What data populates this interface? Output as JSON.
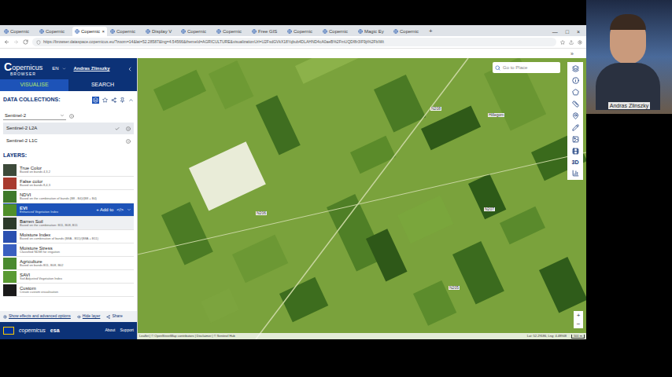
{
  "browser": {
    "tabs": [
      {
        "label": "Copernic",
        "selected": false
      },
      {
        "label": "Copernic",
        "selected": false
      },
      {
        "label": "Copernic",
        "selected": true
      },
      {
        "label": "Copernic",
        "selected": false
      },
      {
        "label": "Display V",
        "selected": false
      },
      {
        "label": "Copernic",
        "selected": false
      },
      {
        "label": "Copernic",
        "selected": false
      },
      {
        "label": "Free GIS",
        "selected": false
      },
      {
        "label": "Copernic",
        "selected": false
      },
      {
        "label": "Copernic",
        "selected": false
      },
      {
        "label": "Magic Ey",
        "selected": false
      },
      {
        "label": "Copernic",
        "selected": false
      }
    ],
    "tab_close": "×",
    "new_tab": "+",
    "window_controls": [
      "—",
      "□",
      "×"
    ],
    "url": "https://browser.dataspace.copernicus.eu/?zoom=14&lat=52.28587&lng=4.54566&themeId=AGRICULTURE&visualizationUrl=U2FsdGVkX18Yqbub4DLAHND4cA0aeB%2FmUQDf8r3IF9jt%2FbIWt",
    "overflow": "»"
  },
  "app": {
    "logo": {
      "name": "opernicus",
      "sub": "BROWSER",
      "initial": "C"
    },
    "language": "EN",
    "user": "Andras Zlinszky",
    "tabs": [
      {
        "label": "VISUALISE",
        "selected": true
      },
      {
        "label": "SEARCH",
        "selected": false
      }
    ],
    "data_collections": {
      "label": "DATA COLLECTIONS:",
      "dropdown": "Sentinel-2",
      "items": [
        {
          "label": "Sentinel-2 L2A",
          "selected": true
        },
        {
          "label": "Sentinel-2 L1C",
          "selected": false
        }
      ]
    },
    "layers": {
      "label": "LAYERS:",
      "items": [
        {
          "title": "True Color",
          "description": "Based on bands 4,3,2",
          "selected": false,
          "hovered": false,
          "color": "#3d4a3a"
        },
        {
          "title": "False color",
          "description": "Based on bands 8,4,3",
          "selected": false,
          "hovered": false,
          "color": "#a83a2e"
        },
        {
          "title": "NDVI",
          "description": "Based on the combination of bands (B8 - B4)/(B8 + B4)",
          "selected": false,
          "hovered": false,
          "color": "#3f7a2a"
        },
        {
          "title": "EVI",
          "description": "Enhanced Vegetation Index",
          "selected": true,
          "hovered": false,
          "color": "#4f8f2a"
        },
        {
          "title": "Barren Soil",
          "description": "Based on the combination: B11, B08, B11",
          "selected": false,
          "hovered": true,
          "color": "#2c3a2a"
        },
        {
          "title": "Moisture Index",
          "description": "Based on combination of bands (B8A - B11)/(B8A + B11)",
          "selected": false,
          "hovered": false,
          "color": "#2a4fb0"
        },
        {
          "title": "Moisture Stress",
          "description": "Classified NDMI for irrigation",
          "selected": false,
          "hovered": false,
          "color": "#3a5fc0"
        },
        {
          "title": "Agriculture",
          "description": "Based on bands B11, B08, B02",
          "selected": false,
          "hovered": false,
          "color": "#4a8a30"
        },
        {
          "title": "SAVI",
          "description": "Soil Adjusted Vegetation Index",
          "selected": false,
          "hovered": false,
          "color": "#5a9a32"
        },
        {
          "title": "Custom",
          "description": "Create custom visualisation",
          "selected": false,
          "hovered": false,
          "color": "#1a1a1a"
        }
      ]
    },
    "selected_actions": {
      "add": "+ Add to",
      "code": "</>"
    },
    "options": [
      "Show effects and advanced options",
      "Hide layer",
      "Share"
    ],
    "footer": {
      "logos": [
        "copernicus",
        "esa"
      ],
      "links": [
        "About",
        "Support"
      ]
    }
  },
  "map": {
    "search_placeholder": "Go to Place",
    "place_labels": [
      "Hillegom",
      "N208",
      "N206",
      "N205",
      "N207"
    ],
    "toolbar_3d": "3D",
    "zoom": [
      "+",
      "−"
    ],
    "attribution": "Leaflet | © OpenStreetMap contributors | Disclaimer | © Sentinel Hub",
    "coordinates": "Lat: 52.29186, Lng: 4.48948",
    "scale": "500 m"
  },
  "webcam": {
    "name": "Andras Zlinszky"
  }
}
